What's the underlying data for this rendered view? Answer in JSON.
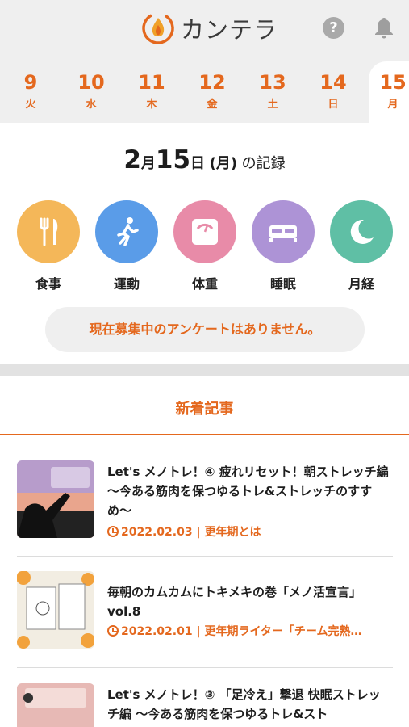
{
  "app": {
    "name": "カンテラ"
  },
  "colors": {
    "accent": "#e4681e",
    "meal": "#f4b759",
    "exercise": "#5a9ce8",
    "weight": "#e88ba8",
    "sleep": "#ad93d6",
    "period": "#5fbfa5"
  },
  "header": {
    "help_icon": "question-icon",
    "bell_icon": "bell-icon",
    "help_glyph": "?"
  },
  "dates": [
    {
      "num": "9",
      "dow": "火"
    },
    {
      "num": "10",
      "dow": "水"
    },
    {
      "num": "11",
      "dow": "木"
    },
    {
      "num": "12",
      "dow": "金"
    },
    {
      "num": "13",
      "dow": "土"
    },
    {
      "num": "14",
      "dow": "日"
    },
    {
      "num": "15",
      "dow": "月",
      "selected": true
    }
  ],
  "record": {
    "month": "2",
    "month_unit": "月",
    "day": "15",
    "day_unit": "日",
    "weekday": "(月)",
    "suffix": "の記録"
  },
  "categories": [
    {
      "label": "食事",
      "icon": "fork-knife-icon"
    },
    {
      "label": "運動",
      "icon": "running-icon"
    },
    {
      "label": "体重",
      "icon": "scale-icon"
    },
    {
      "label": "睡眠",
      "icon": "bed-icon"
    },
    {
      "label": "月経",
      "icon": "moon-icon"
    }
  ],
  "notice": "現在募集中のアンケートはありません。",
  "section_title": "新着記事",
  "articles": [
    {
      "title": "Let's メノトレ！④ 疲れリセット！朝ストレッチ編 〜今ある筋肉を保つゆるトレ&ストレッチのすすめ〜",
      "date": "2022.02.03",
      "category": "| 更年期とは"
    },
    {
      "title": "毎朝のカムカムにトキメキの巻「メノ活宣言」vol.8",
      "date": "2022.02.01",
      "category": "| 更年期ライター「チーム完熟…"
    },
    {
      "title": "Let's メノトレ！③ 「足冷え」撃退 快眠ストレッチ編 〜今ある筋肉を保つゆるトレ&スト",
      "date": "",
      "category": ""
    }
  ]
}
